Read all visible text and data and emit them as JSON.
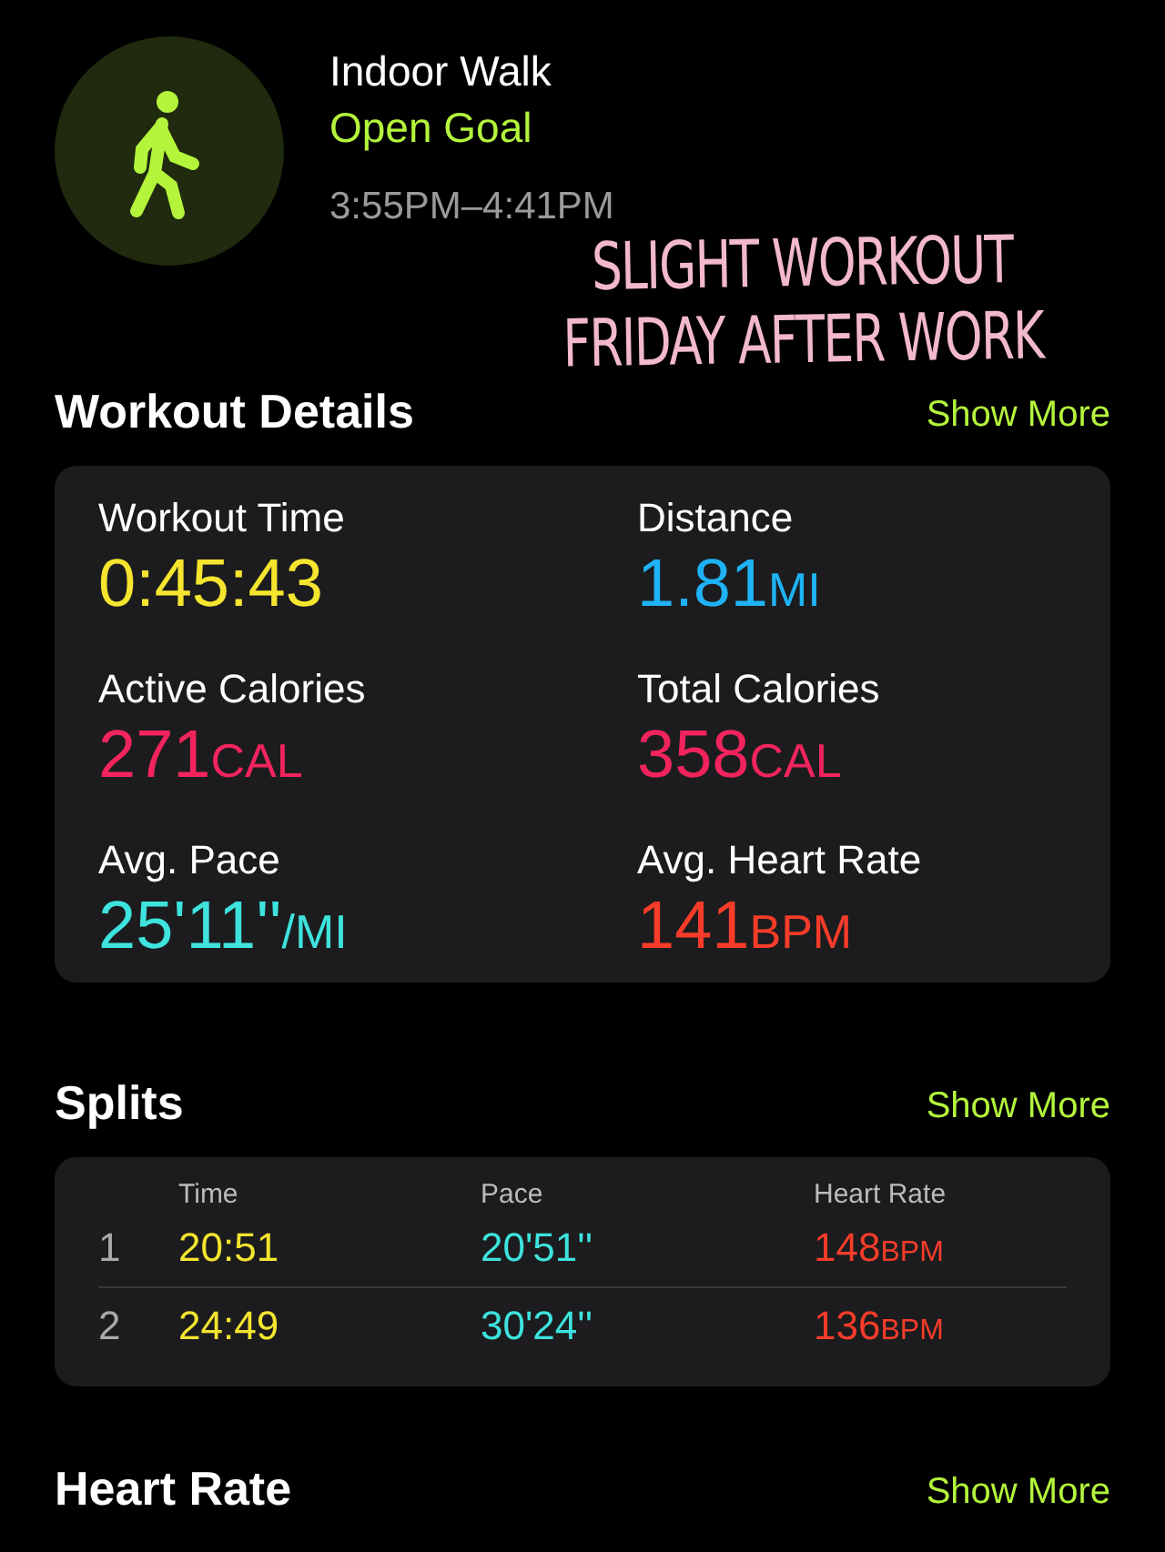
{
  "workout": {
    "title": "Indoor Walk",
    "goal": "Open Goal",
    "time_range": "3:55PM–4:41PM"
  },
  "annotation": {
    "lines": [
      "SLIGHT WORKOUT",
      "FRIDAY AFTER WORK"
    ]
  },
  "workout_details": {
    "title": "Workout Details",
    "action": "Show More",
    "metrics": [
      {
        "label": "Workout Time",
        "value": "0:45:43",
        "color": "#f5e52f"
      },
      {
        "label": "Distance",
        "value": "1.81",
        "unit": "MI",
        "color": "#1fb3f5"
      },
      {
        "label": "Active Calories",
        "value": "271",
        "unit": "CAL",
        "color": "#f2245e"
      },
      {
        "label": "Total Calories",
        "value": "358",
        "unit": "CAL",
        "color": "#f2245e"
      },
      {
        "label": "Avg. Pace",
        "value": "25'11''",
        "unit": "/MI",
        "color": "#3ee3de"
      },
      {
        "label": "Avg. Heart Rate",
        "value": "141",
        "unit": "BPM",
        "color": "#f73c2a"
      }
    ]
  },
  "splits": {
    "title": "Splits",
    "action": "Show More",
    "columns": [
      "Time",
      "Pace",
      "Heart Rate"
    ],
    "rows": [
      {
        "index": "1",
        "time": "20:51",
        "pace": "20'51''",
        "heart_rate": "148",
        "unit": "BPM"
      },
      {
        "index": "2",
        "time": "24:49",
        "pace": "30'24''",
        "heart_rate": "136",
        "unit": "BPM"
      }
    ]
  },
  "heart_rate": {
    "title": "Heart Rate",
    "action": "Show More"
  }
}
